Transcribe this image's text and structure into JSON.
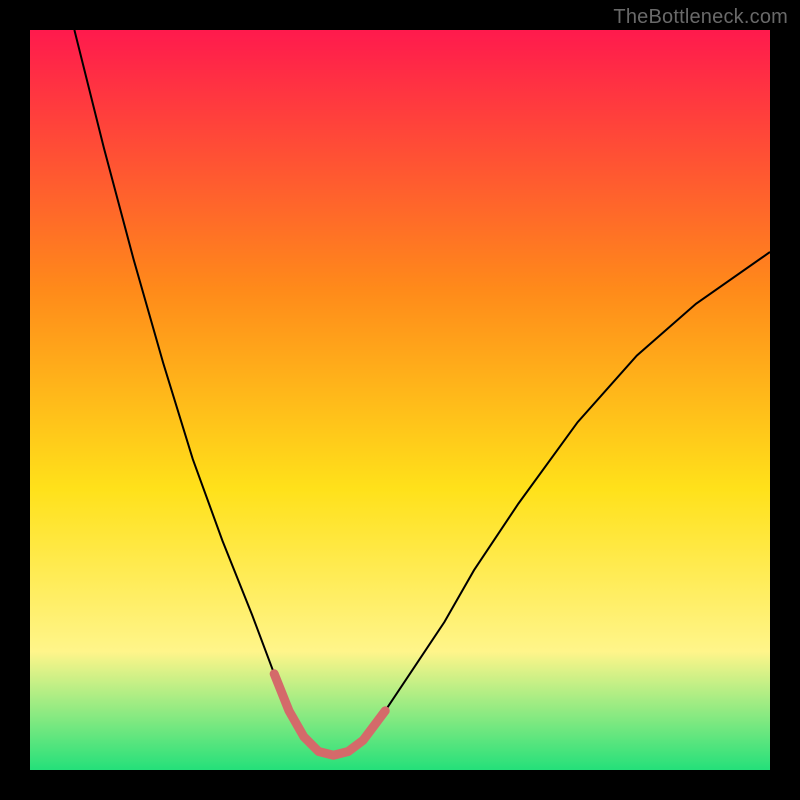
{
  "watermark": {
    "text": "TheBottleneck.com"
  },
  "chart_data": {
    "type": "line",
    "title": "",
    "xlabel": "",
    "ylabel": "",
    "xlim": [
      0,
      100
    ],
    "ylim": [
      0,
      100
    ],
    "grid": false,
    "legend": false,
    "background_gradient": {
      "top": "#ff1a4d",
      "mid_upper": "#ff8a1a",
      "mid": "#ffe11a",
      "mid_lower": "#fff58a",
      "bottom": "#24e07a"
    },
    "series": [
      {
        "name": "bottleneck-curve",
        "color": "#000000",
        "stroke_width": 2,
        "x": [
          6,
          10,
          14,
          18,
          22,
          26,
          30,
          33,
          35,
          37,
          39,
          41,
          43,
          45,
          48,
          52,
          56,
          60,
          66,
          74,
          82,
          90,
          100
        ],
        "y": [
          100,
          84,
          69,
          55,
          42,
          31,
          21,
          13,
          8,
          4.5,
          2.5,
          2,
          2.5,
          4,
          8,
          14,
          20,
          27,
          36,
          47,
          56,
          63,
          70
        ]
      },
      {
        "name": "highlight-valley",
        "color": "#d46a6a",
        "stroke_width": 9,
        "x": [
          33,
          35,
          37,
          39,
          41,
          43,
          45,
          48
        ],
        "y": [
          13,
          8,
          4.5,
          2.5,
          2,
          2.5,
          4,
          8
        ]
      }
    ]
  }
}
